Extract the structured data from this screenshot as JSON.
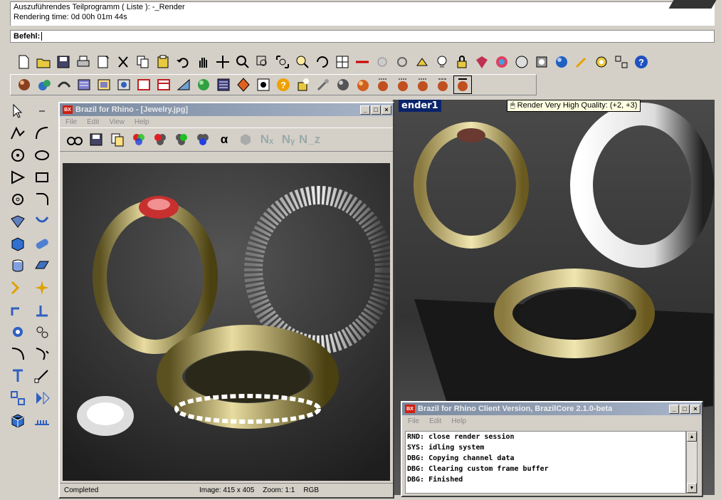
{
  "history": {
    "line1": "Auszuführendes Teilprogramm ( Liste ): -_Render",
    "line2": "Rendering time: 0d 00h 01m 44s"
  },
  "command": {
    "prompt": "Befehl:"
  },
  "tooltip": {
    "text": "Render Very High Quality: (+2, +3)"
  },
  "viewport": {
    "title": "ender1"
  },
  "render_window": {
    "title": "Brazil for Rhino - [Jewelry.jpg]",
    "menu": [
      "File",
      "Edit",
      "View",
      "Help"
    ],
    "toolbar_letters": {
      "alpha": "α",
      "nx": "Nₓ",
      "ny": "Nᵧ",
      "nz": "N_z"
    },
    "status": {
      "state": "Completed",
      "image": "Image: 415 x 405",
      "zoom": "Zoom: 1:1",
      "mode": "RGB"
    }
  },
  "client_window": {
    "title": "Brazil for Rhino Client Version, BrazilCore 2.1.0-beta",
    "menu": [
      "File",
      "Edit",
      "Help"
    ],
    "log": [
      "RND: close render session",
      "SYS: idling system",
      "DBG: Copying channel data",
      "DBG: Clearing custom frame buffer",
      "DBG: Finished"
    ]
  },
  "colors": {
    "titlebar": "#7a8aa0",
    "viewport_title": "#0a246a",
    "tooltip_bg": "#ffffe1"
  }
}
